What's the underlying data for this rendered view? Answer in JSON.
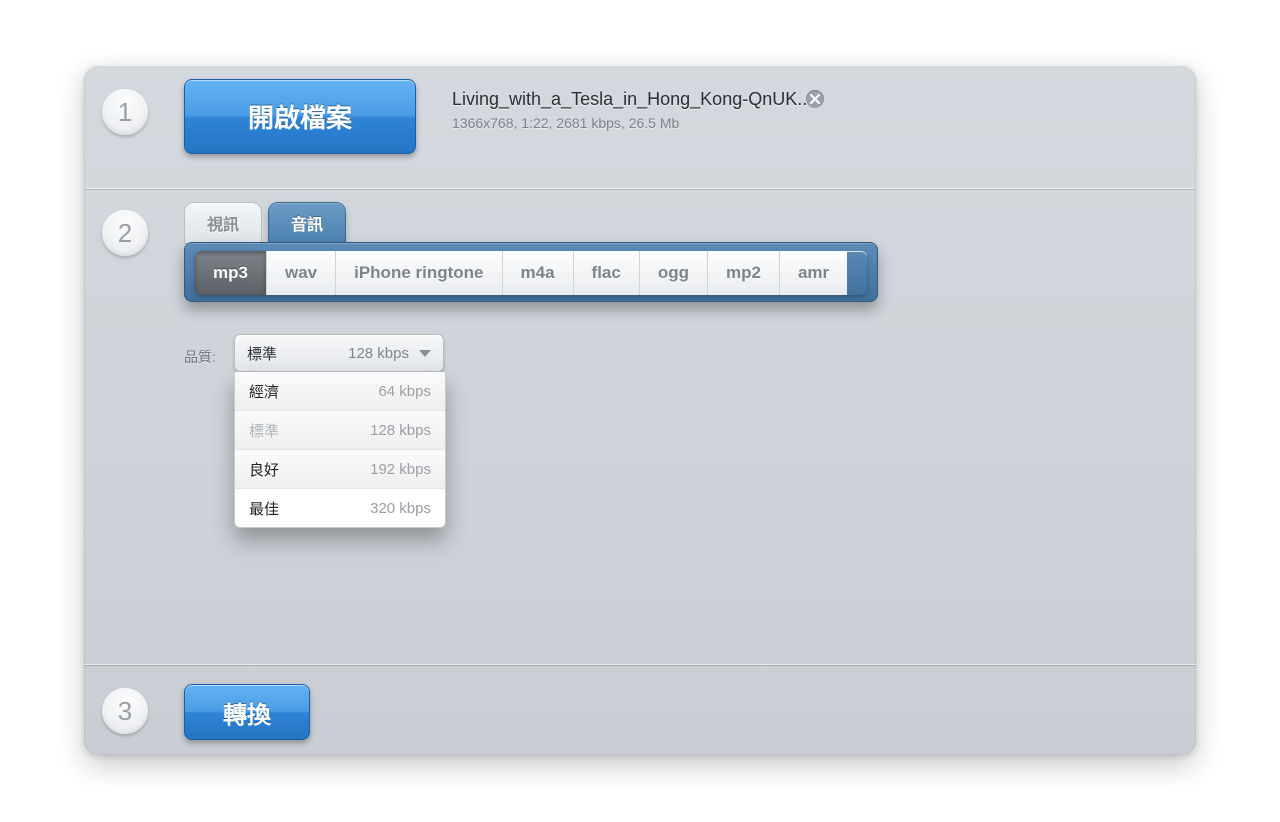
{
  "steps": {
    "s1": "1",
    "s2": "2",
    "s3": "3"
  },
  "buttons": {
    "open": "開啟檔案",
    "convert": "轉換"
  },
  "file": {
    "name": "Living_with_a_Tesla_in_Hong_Kong-QnUK...",
    "meta": "1366x768, 1:22, 2681 kbps, 26.5 Mb"
  },
  "tabs": {
    "video": "視訊",
    "audio": "音訊"
  },
  "formats": {
    "mp3": "mp3",
    "wav": "wav",
    "iphone": "iPhone ringtone",
    "m4a": "m4a",
    "flac": "flac",
    "ogg": "ogg",
    "mp2": "mp2",
    "amr": "amr"
  },
  "quality": {
    "label": "品質:",
    "selected_name": "標準",
    "selected_value": "128 kbps",
    "options": [
      {
        "name": "經濟",
        "value": "64 kbps",
        "disabled": false,
        "highlight": false
      },
      {
        "name": "標準",
        "value": "128 kbps",
        "disabled": true,
        "highlight": false
      },
      {
        "name": "良好",
        "value": "192 kbps",
        "disabled": false,
        "highlight": false
      },
      {
        "name": "最佳",
        "value": "320 kbps",
        "disabled": false,
        "highlight": true
      }
    ]
  }
}
